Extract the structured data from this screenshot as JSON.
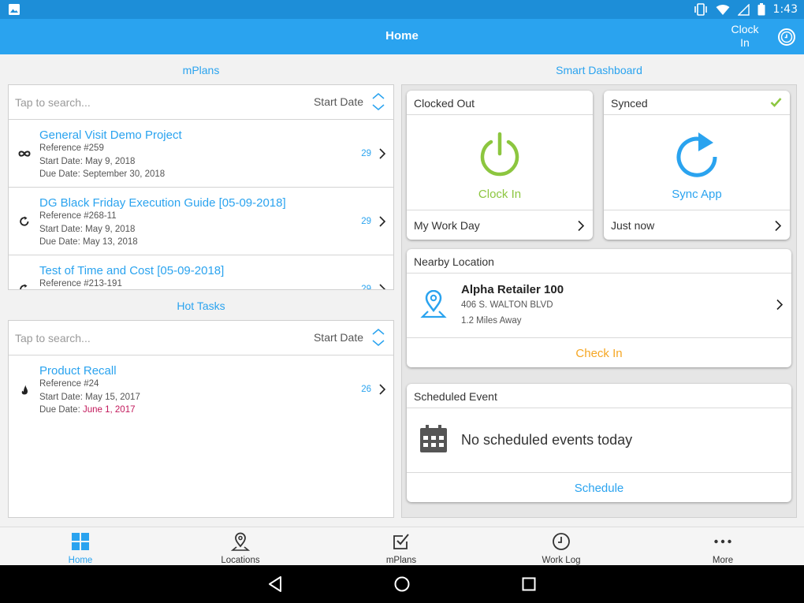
{
  "status_bar": {
    "time": "1:43"
  },
  "app_bar": {
    "title": "Home",
    "clock_in_label": "Clock In"
  },
  "mplans": {
    "section_label": "mPlans",
    "search_placeholder": "Tap to search...",
    "sort_label": "Start Date",
    "items": [
      {
        "icon": "infinity-icon",
        "title": "General Visit Demo Project",
        "reference": "Reference #259",
        "start": "Start Date: May 9, 2018",
        "due": "Due Date: September 30, 2018",
        "count": "29"
      },
      {
        "icon": "refresh-icon",
        "title": "DG Black Friday Execution Guide [05-09-2018]",
        "reference": "Reference #268-11",
        "start": "Start Date: May 9, 2018",
        "due": "Due Date: May 13, 2018",
        "count": "29"
      },
      {
        "icon": "refresh-icon",
        "title": "Test of Time and Cost [05-09-2018]",
        "reference": "Reference #213-191",
        "start": "",
        "due": "",
        "count": "29"
      }
    ]
  },
  "hot_tasks": {
    "section_label": "Hot Tasks",
    "search_placeholder": "Tap to search...",
    "sort_label": "Start Date",
    "items": [
      {
        "icon": "flame-icon",
        "title": "Product Recall",
        "reference": "Reference #24",
        "start": "Start Date: May 15, 2017",
        "due_label": "Due Date: ",
        "due_value": "June 1, 2017",
        "count": "26"
      }
    ]
  },
  "dashboard": {
    "section_label": "Smart Dashboard",
    "clock_card": {
      "header": "Clocked Out",
      "action": "Clock In",
      "footer": "My Work Day",
      "color": "#8cc63f"
    },
    "sync_card": {
      "header": "Synced",
      "action": "Sync App",
      "footer": "Just now",
      "color": "#2aa3ef"
    },
    "nearby": {
      "header": "Nearby Location",
      "name": "Alpha Retailer 100",
      "address": "406 S. WALTON BLVD",
      "distance": "1.2 Miles Away",
      "action": "Check In",
      "action_color": "#f5a623"
    },
    "scheduled": {
      "header": "Scheduled Event",
      "message": "No scheduled events today",
      "action": "Schedule"
    }
  },
  "bottom_nav": [
    {
      "label": "Home",
      "icon": "grid-icon",
      "active": true
    },
    {
      "label": "Locations",
      "icon": "location-pin-icon",
      "active": false
    },
    {
      "label": "mPlans",
      "icon": "checkbox-icon",
      "active": false
    },
    {
      "label": "Work Log",
      "icon": "clock-icon",
      "active": false
    },
    {
      "label": "More",
      "icon": "more-dots-icon",
      "active": false
    }
  ],
  "colors": {
    "accent": "#2aa3ef",
    "status_bar": "#1d8ed8",
    "overdue": "#c2185b"
  }
}
